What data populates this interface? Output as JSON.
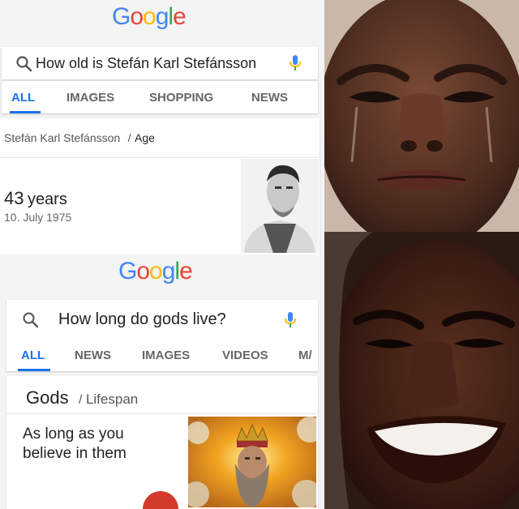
{
  "top_panel": {
    "logo_letters": [
      {
        "ch": "G",
        "color": "#4285F4"
      },
      {
        "ch": "o",
        "color": "#EA4335"
      },
      {
        "ch": "o",
        "color": "#FBBC05"
      },
      {
        "ch": "g",
        "color": "#4285F4"
      },
      {
        "ch": "l",
        "color": "#34A853"
      },
      {
        "ch": "e",
        "color": "#EA4335"
      }
    ],
    "search_query": "How old is Stefán Karl Stefánsson",
    "tabs": [
      "ALL",
      "IMAGES",
      "SHOPPING",
      "NEWS"
    ],
    "breadcrumb_entity": "Stefán Karl Stefánsson",
    "breadcrumb_sep": "/",
    "breadcrumb_attr": "Age",
    "age_number": "43",
    "age_unit": "years",
    "birth_date": "10. July 1975"
  },
  "bottom_panel": {
    "logo_letters": [
      {
        "ch": "G",
        "color": "#4285F4"
      },
      {
        "ch": "o",
        "color": "#EA4335"
      },
      {
        "ch": "o",
        "color": "#FBBC05"
      },
      {
        "ch": "g",
        "color": "#4285F4"
      },
      {
        "ch": "l",
        "color": "#34A853"
      },
      {
        "ch": "e",
        "color": "#EA4335"
      }
    ],
    "search_query": "How long do gods live?",
    "tabs": [
      "ALL",
      "NEWS",
      "IMAGES",
      "VIDEOS",
      "M/"
    ],
    "breadcrumb_entity": "Gods",
    "breadcrumb_sep": "/",
    "breadcrumb_attr": "Lifespan",
    "answer_line1": "As long as you",
    "answer_line2": "believe in them"
  },
  "colors": {
    "accent": "#1a73e8",
    "mic_blue": "#4285F4",
    "fab_red": "#d23a2c"
  },
  "icons": [
    "search-icon",
    "mic-icon",
    "portrait-photo",
    "god-image",
    "crying-face",
    "smiling-face"
  ]
}
